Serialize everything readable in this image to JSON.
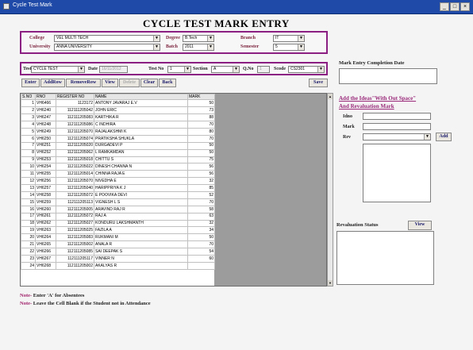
{
  "window": {
    "title": "Cycle Test Mark",
    "buttons": [
      "_",
      "□",
      "×"
    ]
  },
  "header": {
    "title": "CYCLE TEST MARK ENTRY"
  },
  "filters": {
    "college_label": "College",
    "college_value": "VEL MULTI TECH",
    "university_label": "University",
    "university_value": "ANNA UNIVERSITY",
    "degree_label": "Degree",
    "degree_value": "B.Tech",
    "batch_label": "Batch",
    "batch_value": "2011",
    "branch_label": "Branch",
    "branch_value": "IT",
    "semester_label": "Semester",
    "semester_value": "5"
  },
  "test": {
    "test_label": "Test",
    "test_value": "CYCLE TEST",
    "date_label": "Date",
    "date_value": "16/11/2012",
    "testno_label": "Test No",
    "testno_value": "1",
    "section_label": "Section",
    "section_value": "A",
    "qno_label": "Q.No",
    "qno_value": "1",
    "scode_label": "Scode",
    "scode_value": "CS2301"
  },
  "toolbar": {
    "enter": "Enter",
    "addrow": "AddRow",
    "removerow": "RemoveRow",
    "view": "View",
    "delete": "Delete",
    "clear": "Clear",
    "back": "Back",
    "save": "Save"
  },
  "grid": {
    "columns": [
      "S.NO",
      "RNO",
      "REGISTER NO",
      "NAME",
      "MARK"
    ],
    "rows": [
      [
        "1",
        "VH6466",
        "1123172",
        "ANTONY JAVARAJ E.V",
        "50"
      ],
      [
        "2",
        "VH6240",
        "112111205042",
        "JOHN ERIC",
        "73"
      ],
      [
        "3",
        "VH6247",
        "112111205083",
        "KARTHIKA R",
        "88"
      ],
      [
        "4",
        "VH6248",
        "112111205086",
        "C INDHIRA",
        "70"
      ],
      [
        "5",
        "VH6249",
        "112111205070",
        "RAJALAKSHMI K",
        "80"
      ],
      [
        "6",
        "VH6250",
        "112111205074",
        "PRATIKSHA SHUKLA",
        "70"
      ],
      [
        "7",
        "VH6251",
        "112111205020",
        "DURGADEVI P",
        "50"
      ],
      [
        "8",
        "VH6252",
        "112111205062",
        "L RAMKAMDAN",
        "50"
      ],
      [
        "9",
        "VH6253",
        "112111205018",
        "CHITTU S",
        "75"
      ],
      [
        "10",
        "VH6254",
        "112111205022",
        "DINESH CHANNA N",
        "56"
      ],
      [
        "11",
        "VH6255",
        "112111205014",
        "CHINNA RAJA E",
        "56"
      ],
      [
        "12",
        "VH6256",
        "112111205070",
        "NIVEDHA E",
        "32"
      ],
      [
        "13",
        "VH6257",
        "112111205040",
        "HARIPPRIYA K J",
        "85"
      ],
      [
        "14",
        "VH6258",
        "112111205072",
        "E POOVIKA DEVI",
        "52"
      ],
      [
        "15",
        "VH6259",
        "112111205113",
        "VIGNESH L S",
        "70"
      ],
      [
        "16",
        "VH6260",
        "112111205005",
        "ARAVIND RAJ R",
        "58"
      ],
      [
        "17",
        "VH6261",
        "112111205072",
        "RAJ A",
        "63"
      ],
      [
        "18",
        "VH6262",
        "112111205027",
        "KONDURU LAKSHMANTH",
        "32"
      ],
      [
        "19",
        "VH6263",
        "112111205025",
        "FAZILA A",
        "34"
      ],
      [
        "20",
        "VH6264",
        "112111205083",
        "RUKMANI M",
        "50"
      ],
      [
        "21",
        "VH6265",
        "112111205002",
        "ANALA R",
        "70"
      ],
      [
        "22",
        "VH6266",
        "112111205085",
        "SAI DEEPAK S",
        "54"
      ],
      [
        "23",
        "VH6267",
        "112111205117",
        "VINNER N",
        "60"
      ],
      [
        "24",
        "VH6268",
        "112111205002",
        "AKALYAS R",
        ""
      ]
    ]
  },
  "notes": {
    "note1_prefix": "Note-",
    "note1_text": " Enter 'A' for Absentees",
    "note2_prefix": "Note-",
    "note2_text": " Leave the Cell Blank if the Student not in Attendance"
  },
  "right": {
    "completion_label": "Mark Entry Completion Date",
    "completion_value": "",
    "add_ideas_line1": "Add the Ideas\"With Out Space\"",
    "add_ideas_line2": "And Revaluation Mark",
    "idno_label": "Idno",
    "mark_label": "Mark",
    "rev_label": "Rev",
    "add_button": "Add",
    "reval_status_label": "Revaluation Status",
    "view_button": "View"
  },
  "colors": {
    "titlebar": "#1f4aa8",
    "box_border": "#8b1f82",
    "note_prefix": "#a0226b"
  }
}
